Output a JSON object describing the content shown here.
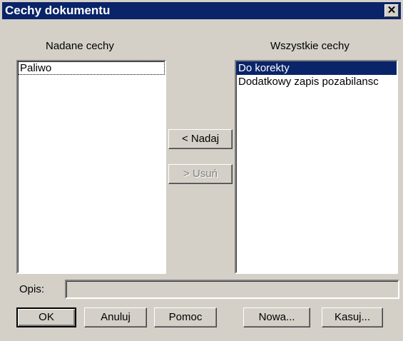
{
  "window": {
    "title": "Cechy dokumentu"
  },
  "left_list": {
    "label": "Nadane cechy",
    "items": [
      "Paliwo"
    ]
  },
  "right_list": {
    "label": "Wszystkie cechy",
    "items": [
      "Do korekty",
      "Dodatkowy zapis pozabilansc"
    ]
  },
  "middle_buttons": {
    "assign": "< Nadaj",
    "remove": "> Usuń"
  },
  "description": {
    "label": "Opis:",
    "value": ""
  },
  "footer_buttons": {
    "ok": "OK",
    "cancel": "Anuluj",
    "help": "Pomoc",
    "new": "Nowa...",
    "delete": "Kasuj..."
  },
  "colors": {
    "titlebar": "#0a246a",
    "selection": "#0a246a",
    "face": "#d4d0c8"
  },
  "icons": {
    "close": "close-icon"
  }
}
